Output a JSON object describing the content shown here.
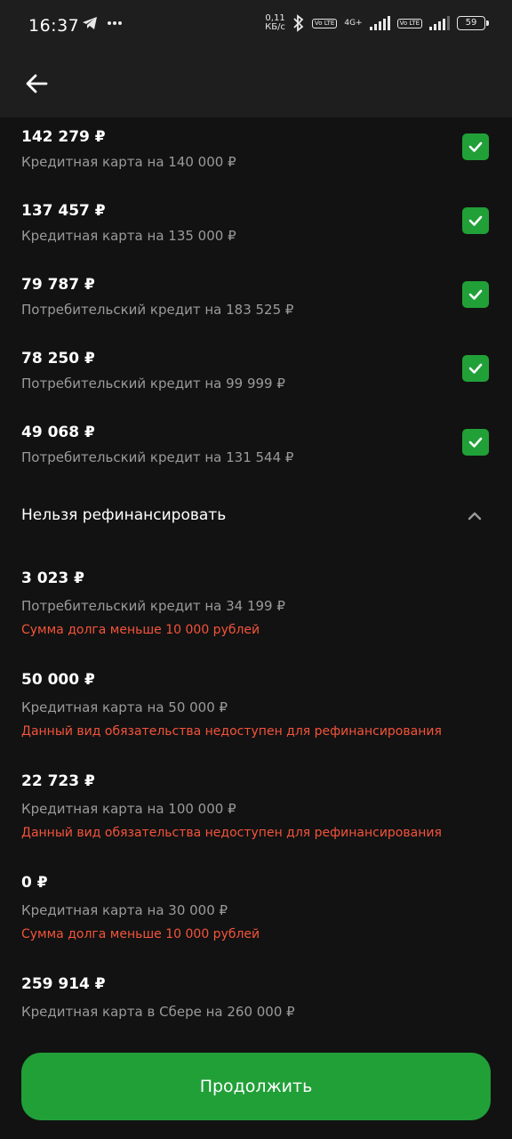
{
  "status_bar": {
    "time": "16:37",
    "net_speed_value": "0,11",
    "net_speed_unit": "КБ/с",
    "volte1": "Vo LTE",
    "network_type": "4G+",
    "volte2": "Vo LTE",
    "battery": "59",
    "icons": [
      "telegram-icon",
      "more-dots-icon",
      "bluetooth-icon",
      "signal-icon",
      "battery-icon"
    ]
  },
  "header": {
    "back_icon": "arrow-left-icon"
  },
  "eligible_loans": [
    {
      "amount": "142 279 ₽",
      "description": "Кредитная карта на 140 000 ₽",
      "checked": true
    },
    {
      "amount": "137 457 ₽",
      "description": "Кредитная карта на 135 000 ₽",
      "checked": true
    },
    {
      "amount": "79 787 ₽",
      "description": "Потребительский кредит на 183 525 ₽",
      "checked": true
    },
    {
      "amount": "78 250 ₽",
      "description": "Потребительский кредит на 99 999 ₽",
      "checked": true
    },
    {
      "amount": "49 068 ₽",
      "description": "Потребительский кредит на 131 544 ₽",
      "checked": true
    }
  ],
  "ineligible_section": {
    "title": "Нельзя рефинансировать",
    "expanded": true,
    "items": [
      {
        "amount": "3 023 ₽",
        "description": "Потребительский кредит на 34 199 ₽",
        "reason": "Сумма долга меньше 10 000 рублей"
      },
      {
        "amount": "50 000 ₽",
        "description": "Кредитная карта на 50 000 ₽",
        "reason": "Данный вид обязательства недоступен для рефинансирования"
      },
      {
        "amount": "22 723 ₽",
        "description": "Кредитная карта на 100 000 ₽",
        "reason": "Данный вид обязательства недоступен для рефинансирования"
      },
      {
        "amount": "0 ₽",
        "description": "Кредитная карта на 30 000 ₽",
        "reason": "Сумма долга меньше 10 000 рублей"
      },
      {
        "amount": "259 914 ₽",
        "description": "Кредитная карта в Сбере на 260 000 ₽",
        "reason": ""
      }
    ]
  },
  "continue_button": {
    "label": "Продолжить"
  },
  "colors": {
    "accent": "#21a038",
    "error": "#f4533a",
    "background": "#121212",
    "header": "#1e1e1e"
  }
}
